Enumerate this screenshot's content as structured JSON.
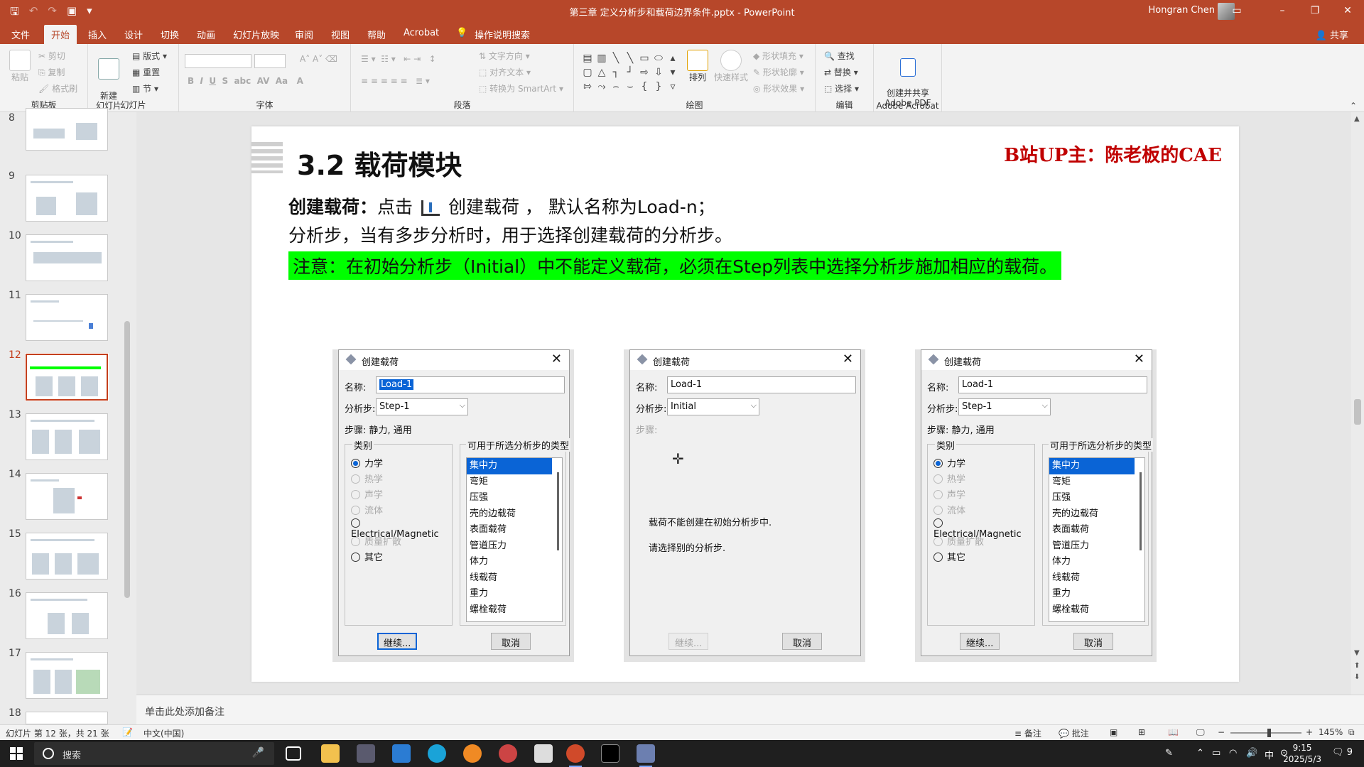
{
  "titlebar": {
    "doc_title": "第三章 定义分析步和载荷边界条件.pptx  -  PowerPoint",
    "user": "Hongran Chen"
  },
  "menu": {
    "tabs": [
      "文件",
      "开始",
      "插入",
      "设计",
      "切换",
      "动画",
      "幻灯片放映",
      "审阅",
      "视图",
      "帮助",
      "Acrobat",
      "操作说明搜索"
    ],
    "active": "开始",
    "share": "共享"
  },
  "ribbon": {
    "clipboard": {
      "paste": "粘贴",
      "cut": "剪切",
      "copy": "复制",
      "format_painter": "格式刷",
      "group": "剪贴板"
    },
    "slides": {
      "new_slide": "新建\n幻灯片",
      "layout": "版式",
      "reset": "重置",
      "section": "节",
      "group": "幻灯片"
    },
    "font": {
      "group": "字体"
    },
    "paragraph": {
      "text_direction": "文字方向",
      "align_text": "对齐文本",
      "smartart": "转换为 SmartArt",
      "group": "段落"
    },
    "drawing": {
      "arrange": "排列",
      "quick_styles": "快速样式",
      "shape_fill": "形状填充",
      "shape_outline": "形状轮廓",
      "shape_effects": "形状效果",
      "group": "绘图"
    },
    "editing": {
      "find": "查找",
      "replace": "替换",
      "select": "选择",
      "group": "编辑"
    },
    "acrobat": {
      "create_pdf": "创建并共享\nAdobe PDF",
      "group": "Adobe Acrobat"
    }
  },
  "thumbnails": {
    "numbers": [
      "8",
      "9",
      "10",
      "11",
      "12",
      "13",
      "14",
      "15",
      "16",
      "17",
      "18"
    ],
    "selected": "12"
  },
  "slide": {
    "heading": "3.2 载荷模块",
    "brand": "B站UP主：陈老板的CAE",
    "line1_bold": "创建载荷：",
    "line1_a": "点击",
    "line1_b": "创建载荷 ，  默认名称为Load-n；",
    "line2": "分析步，当有多步分析时，用于选择创建载荷的分析步。",
    "line3": "注意：在初始分析步（Initial）中不能定义载荷，必须在Step列表中选择分析步施加相应的载荷。"
  },
  "dialogs": {
    "title": "创建载荷",
    "name_label": "名称:",
    "name_value": "Load-1",
    "step_label": "分析步:",
    "procedure_label": "步骤:",
    "procedure_value": "静力, 通用",
    "category_title": "类别",
    "types_title": "可用于所选分析步的类型",
    "categories": [
      "力学",
      "热学",
      "声学",
      "流体",
      "Electrical/Magnetic",
      "质量扩散",
      "其它"
    ],
    "types": [
      "集中力",
      "弯矩",
      "压强",
      "壳的边载荷",
      "表面载荷",
      "管道压力",
      "体力",
      "线载荷",
      "重力",
      "螺栓载荷"
    ],
    "continue": "继续...",
    "cancel": "取消",
    "step_values": [
      "Step-1",
      "Initial",
      "Step-1"
    ],
    "msg1": "载荷不能创建在初始分析步中.",
    "msg2": "请选择别的分析步."
  },
  "notes": {
    "placeholder": "单击此处添加备注"
  },
  "status": {
    "slide_info": "幻灯片 第 12 张，共 21 张",
    "language": "中文(中国)",
    "notes": "备注",
    "comments": "批注",
    "zoom": "145%"
  },
  "taskbar": {
    "search": "搜索",
    "time": "9:15",
    "date": "2025/5/3",
    "ime": "中",
    "notif": "9"
  },
  "colors": {
    "accent": "#b7472a",
    "highlight": "#00ff00",
    "brand": "#c00000",
    "select": "#0a64d6"
  }
}
